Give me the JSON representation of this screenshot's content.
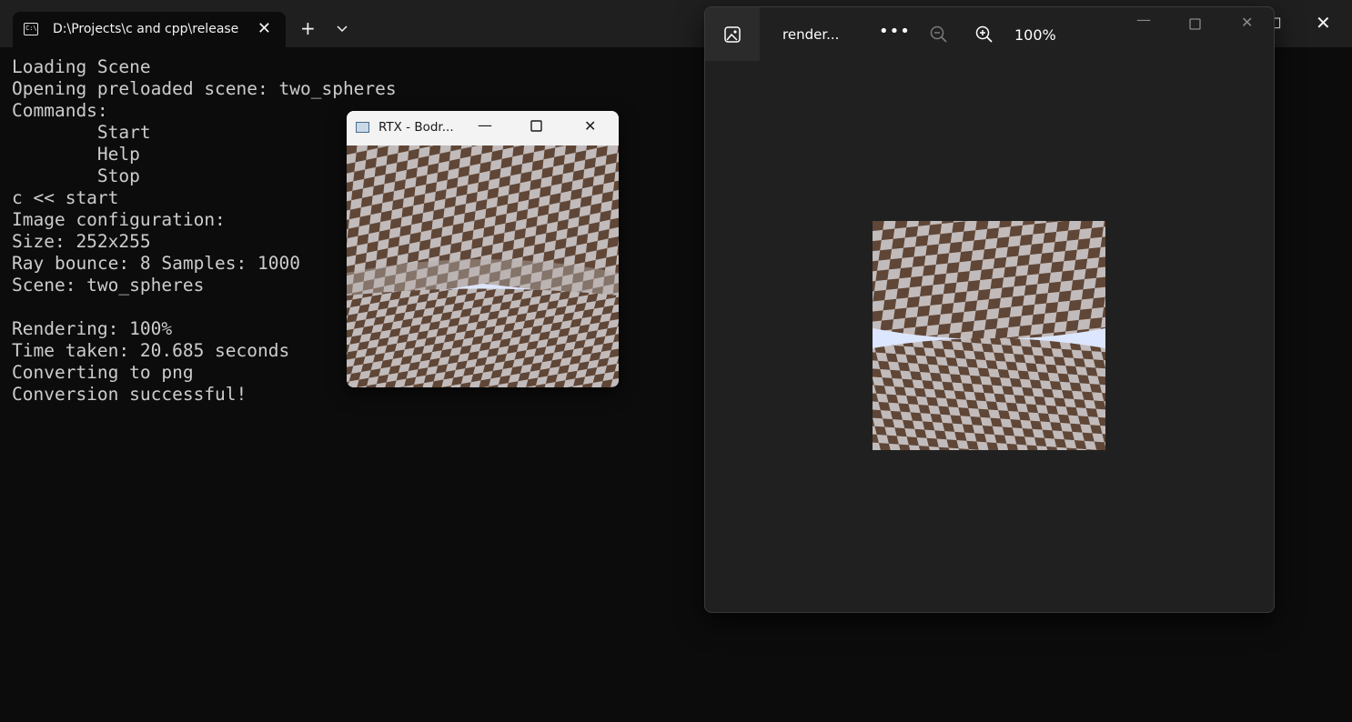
{
  "terminal": {
    "tab_title": "D:\\Projects\\c and cpp\\release",
    "tab_icon_text": "C:\\",
    "new_tab_symbol": "+",
    "lines": [
      "Loading Scene",
      "Opening preloaded scene: two_spheres",
      "Commands:",
      "        Start",
      "        Help",
      "        Stop",
      "c << start",
      "Image configuration:",
      "Size: 252x255",
      "Ray bounce: 8 Samples: 1000",
      "Scene: two_spheres",
      "",
      "Rendering: 100%",
      "Time taken: 20.685 seconds",
      "Converting to png",
      "Conversion successful!"
    ]
  },
  "render_window": {
    "title": "RTX - Bodr..."
  },
  "photos": {
    "filename": "render...",
    "more_label": "•••",
    "zoom": "100%"
  },
  "colors": {
    "checker_dark": "#5f4636",
    "checker_light": "#c2bbbb",
    "sky": "#dde6ff"
  },
  "icons": {
    "gallery": "image-icon",
    "zoom_out": "zoom-out-icon",
    "zoom_in": "zoom-in-icon",
    "more": "more-icon",
    "close": "close-icon",
    "minimize": "minimize-icon",
    "maximize": "maximize-icon"
  }
}
